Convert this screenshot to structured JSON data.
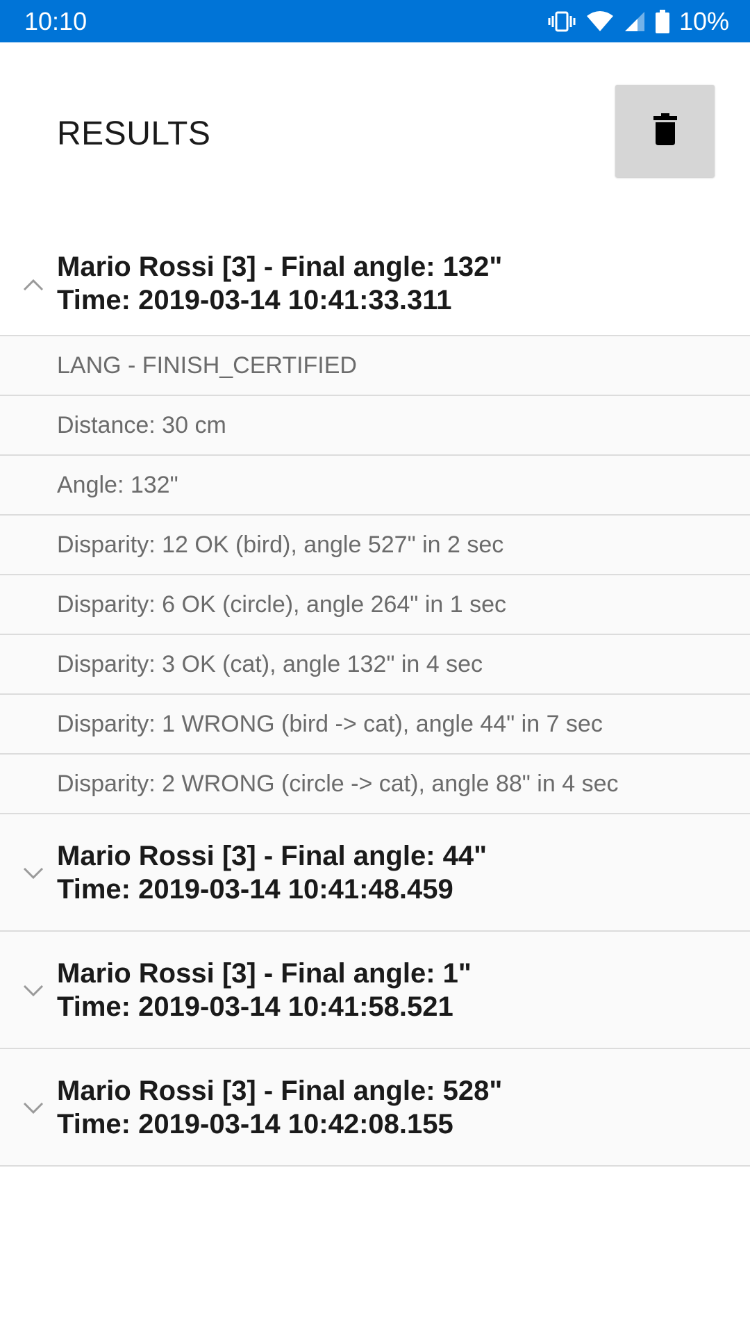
{
  "status_bar": {
    "time": "10:10",
    "battery_percent": "10%",
    "icons": [
      "vibrate-icon",
      "wifi-icon",
      "cell-signal-icon",
      "battery-icon"
    ]
  },
  "header": {
    "title": "RESULTS",
    "delete_icon": "trash-icon"
  },
  "results": [
    {
      "line1": "Mario Rossi [3] - Final angle: 132\"",
      "line2": "Time: 2019-03-14 10:41:33.311",
      "expanded": true,
      "details": [
        "LANG - FINISH_CERTIFIED",
        "Distance: 30 cm",
        "Angle: 132\"",
        "Disparity: 12 OK (bird), angle 527\" in 2 sec",
        "Disparity: 6 OK (circle), angle 264\" in 1 sec",
        "Disparity: 3 OK (cat), angle 132\" in 4 sec",
        "Disparity: 1 WRONG (bird -> cat), angle 44\" in 7 sec",
        "Disparity: 2 WRONG (circle -> cat), angle 88\" in 4 sec"
      ]
    },
    {
      "line1": "Mario Rossi [3] - Final angle: 44\"",
      "line2": "Time: 2019-03-14 10:41:48.459",
      "expanded": false
    },
    {
      "line1": "Mario Rossi [3] - Final angle: 1\"",
      "line2": "Time: 2019-03-14 10:41:58.521",
      "expanded": false
    },
    {
      "line1": "Mario Rossi [3] - Final angle: 528\"",
      "line2": "Time: 2019-03-14 10:42:08.155",
      "expanded": false
    }
  ]
}
